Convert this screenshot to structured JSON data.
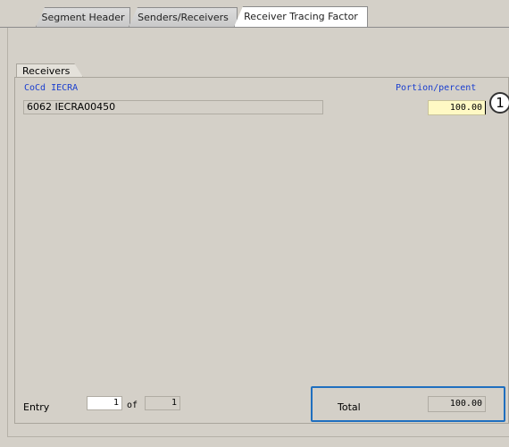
{
  "tabs": [
    {
      "label": "Segment Header"
    },
    {
      "label": "Senders/Receivers"
    },
    {
      "label": "Receiver Tracing Factor"
    }
  ],
  "receivers": {
    "group_title": "Receivers",
    "columns": {
      "cocd_iecra": "CoCd IECRA",
      "portion": "Portion/percent"
    },
    "rows": [
      {
        "cocd_iecra": "6062 IECRA00450",
        "portion": "100.00"
      }
    ]
  },
  "callout": "1",
  "entry": {
    "label": "Entry",
    "current": "1",
    "of_label": "of",
    "total": "1"
  },
  "total": {
    "label": "Total",
    "value": "100.00"
  },
  "colors": {
    "highlight_box": "#1f6fbf",
    "header_text": "#1a3ecf",
    "active_field": "#fff9c4"
  }
}
